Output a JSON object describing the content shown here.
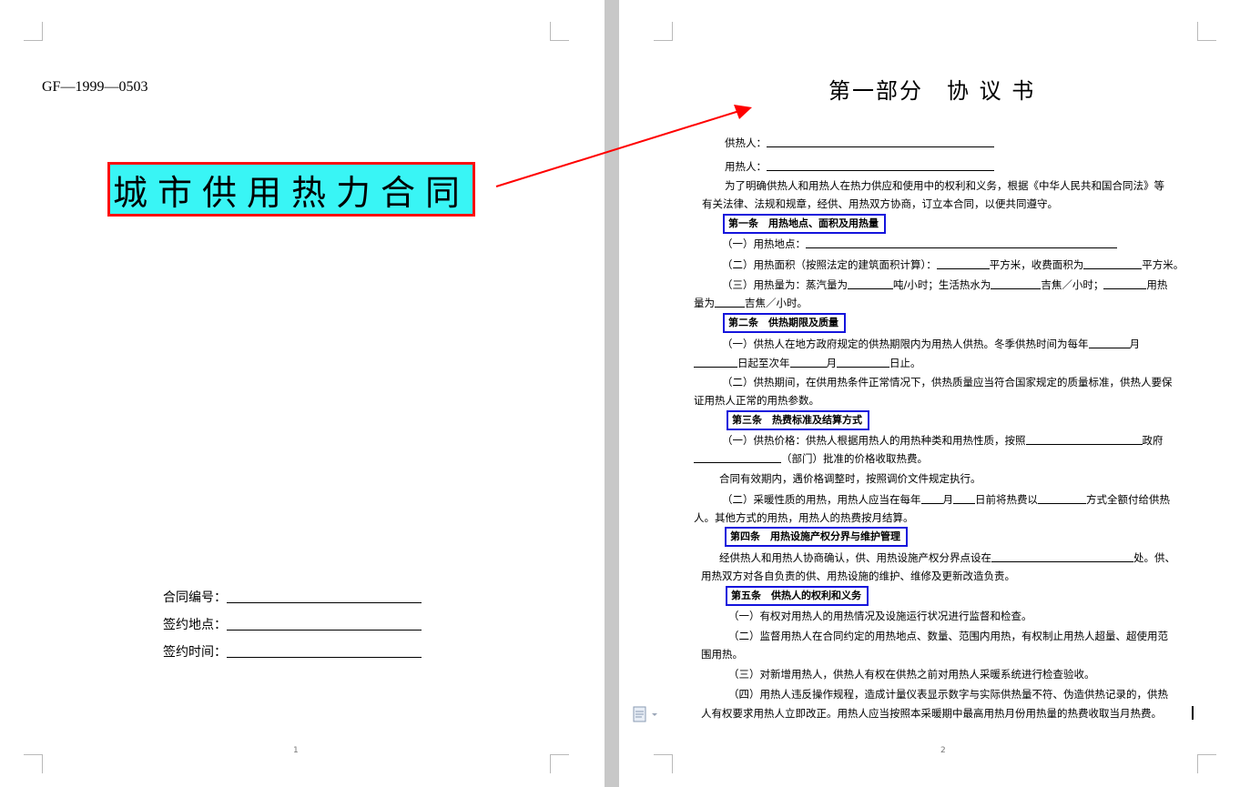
{
  "page1": {
    "doc_code": "GF—1999—0503",
    "title": "城市供用热力合同",
    "contract_no_label": "合同编号：",
    "sign_place_label": "签约地点：",
    "sign_time_label": "签约时间：",
    "page_number": "1"
  },
  "page2": {
    "part_title": "第一部分　协 议 书",
    "supplier_label": "供热人：",
    "user_label": "用热人：",
    "intro_1": "为了明确供热人和用热人在热力供应和使用中的权利和义务，根据《中华人民共和国合同法》等",
    "intro_2": "有关法律、法规和规章，经供、用热双方协商，订立本合同，以便共同遵守。",
    "art1_heading": "第一条　用热地点、面积及用热量",
    "art1_p1": "（一）用热地点：",
    "art1_p2_a": "（二）用热面积（按照法定的建筑面积计算）：",
    "art1_p2_b": "平方米，收费面积为",
    "art1_p2_c": "平方米。",
    "art1_p3_a": "（三）用热量为：蒸汽量为",
    "art1_p3_b": "吨/小时；生活热水为",
    "art1_p3_c": "吉焦／小时；",
    "art1_p3_d": "用热",
    "art1_p3_e": "量为",
    "art1_p3_f": "吉焦／小时。",
    "art2_heading": "第二条　供热期限及质量",
    "art2_p1_a": "（一）供热人在地方政府规定的供热期限内为用热人供热。冬季供热时间为每年",
    "art2_p1_b": "月",
    "art2_p1_c": "日起至次年",
    "art2_p1_d": "月",
    "art2_p1_e": "日止。",
    "art2_p2_1": "（二）供热期间，在供用热条件正常情况下，供热质量应当符合国家规定的质量标准，供热人要保",
    "art2_p2_2": "证用热人正常的用热参数。",
    "art3_heading": "第三条　热费标准及结算方式",
    "art3_p1_a": "（一）供热价格：供热人根据用热人的用热种类和用热性质，按照",
    "art3_p1_b": "政府",
    "art3_p1_c": "（部门）批准的价格收取热费。",
    "art3_p2": "合同有效期内，遇价格调整时，按照调价文件规定执行。",
    "art3_p3_a": "（二）采暖性质的用热，用热人应当在每年",
    "art3_p3_b": "月",
    "art3_p3_c": "日前将热费以",
    "art3_p3_d": "方式全额付给供热",
    "art3_p3_e": "人。其他方式的用热，用热人的热费按月结算。",
    "art4_heading": "第四条　用热设施产权分界与维护管理",
    "art4_p1_a": "经供热人和用热人协商确认，供、用热设施产权分界点设在",
    "art4_p1_b": "处。供、",
    "art4_p1_c": "用热双方对各自负责的供、用热设施的维护、维修及更新改造负责。",
    "art5_heading": "第五条　供热人的权利和义务",
    "art5_p1": "（一）有权对用热人的用热情况及设施运行状况进行监督和检查。",
    "art5_p2_1": "（二）监督用热人在合同约定的用热地点、数量、范围内用热，有权制止用热人超量、超使用范",
    "art5_p2_2": "围用热。",
    "art5_p3": "（三）对新增用热人，供热人有权在供热之前对用热人采暖系统进行检查验收。",
    "art5_p4_1": "（四）用热人违反操作规程，造成计量仪表显示数字与实际供热量不符、伪造供热记录的，供热",
    "art5_p4_2": "人有权要求用热人立即改正。用热人应当按照本采暖期中最高用热月份用热量的热费收取当月热费。",
    "page_number": "2"
  },
  "colors": {
    "title_bg": "#39f5f5",
    "title_border": "#ff1010",
    "heading_border": "#1414dc",
    "arrow": "#ff0000",
    "gutter": "#c8c8c8"
  },
  "icons": {
    "paste_options": "clipboard-icon"
  }
}
